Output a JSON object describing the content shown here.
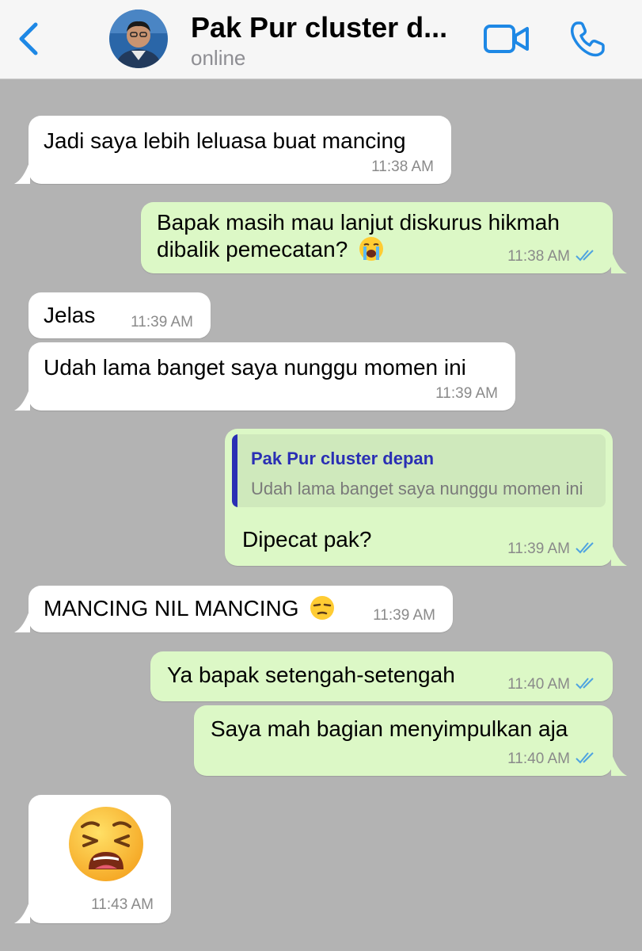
{
  "header": {
    "title": "Pak Pur cluster d...",
    "status": "online"
  },
  "messages": [
    {
      "text": "Jadi saya lebih leluasa buat mancing",
      "time": "11:38 AM"
    },
    {
      "line1": "Bapak masih mau lanjut diskurus hikmah",
      "line2": "dibalik pemecatan?",
      "time": "11:38 AM",
      "emoji": "loudly-crying-face"
    },
    {
      "text": "Jelas",
      "time": "11:39 AM"
    },
    {
      "text": "Udah lama banget saya nunggu momen ini",
      "time": "11:39 AM"
    },
    {
      "quote_name": "Pak Pur cluster depan",
      "quote_text": "Udah lama banget saya nunggu momen ini",
      "text": "Dipecat pak?",
      "time": "11:39 AM"
    },
    {
      "text": "MANCING NIL MANCING",
      "time": "11:39 AM",
      "emoji": "unamused-face"
    },
    {
      "text": "Ya bapak setengah-setengah",
      "time": "11:40 AM"
    },
    {
      "text": "Saya mah bagian menyimpulkan aja",
      "time": "11:40 AM"
    },
    {
      "time": "11:43 AM",
      "emoji": "weary-face"
    }
  ],
  "colors": {
    "background": "#b3b3b3",
    "incoming_bubble": "#ffffff",
    "outgoing_bubble": "#dcf8c6",
    "accent": "#1e88e5",
    "read_ticks": "#4fa3e0"
  }
}
